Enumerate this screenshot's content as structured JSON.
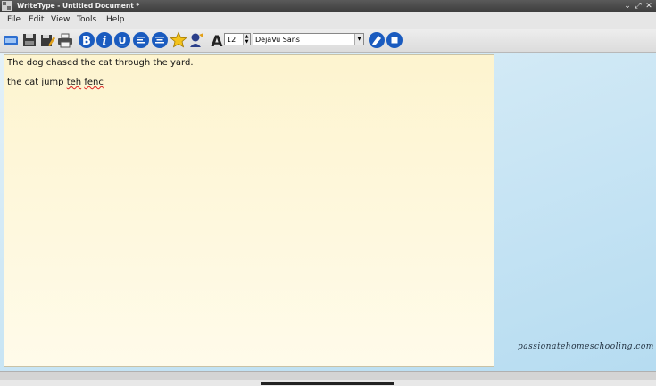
{
  "window": {
    "title": "WriteType - Untitled Document *",
    "controls": [
      "⌄",
      "⤢",
      "✕"
    ]
  },
  "menu": {
    "items": [
      "File",
      "Edit",
      "View",
      "Tools",
      "Help"
    ]
  },
  "toolbar": {
    "icons": [
      "new-document-icon",
      "save-icon",
      "save-as-icon",
      "print-icon",
      "bold-icon",
      "italic-icon",
      "underline-icon",
      "align-left-icon",
      "align-center-icon",
      "star-icon",
      "speak-icon",
      "font-icon",
      "highlight-icon",
      "stop-icon"
    ],
    "bold_label": "B",
    "italic_label": "i",
    "underline_label": "U",
    "font_glyph": "A",
    "font_size": "12",
    "font_name": "DejaVu Sans"
  },
  "document": {
    "line1": "The dog chased the cat through the yard.",
    "line2_start": "the cat jump ",
    "line2_word1": "teh",
    "line2_space": " ",
    "line2_word2": "fenc"
  },
  "watermark": "passionatehomeschooling.com",
  "colors": {
    "accent": "#1a5bbf",
    "page": "#fdf4cf",
    "spellcheck": "#d22222"
  }
}
